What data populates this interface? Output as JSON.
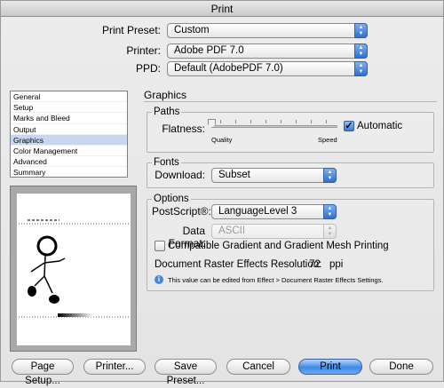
{
  "window": {
    "title": "Print"
  },
  "preset": {
    "label": "Print Preset:",
    "value": "Custom"
  },
  "printer": {
    "label": "Printer:",
    "value": "Adobe PDF 7.0"
  },
  "ppd": {
    "label": "PPD:",
    "value": "Default (AdobePDF 7.0)"
  },
  "sidebar": {
    "items": [
      {
        "label": "General"
      },
      {
        "label": "Setup"
      },
      {
        "label": "Marks and Bleed"
      },
      {
        "label": "Output"
      },
      {
        "label": "Graphics",
        "selected": true
      },
      {
        "label": "Color Management"
      },
      {
        "label": "Advanced"
      },
      {
        "label": "Summary"
      }
    ]
  },
  "main": {
    "title": "Graphics",
    "paths": {
      "title": "Paths",
      "flatness_label": "Flatness:",
      "quality_label": "Quality",
      "speed_label": "Speed",
      "automatic_label": "Automatic",
      "automatic_checked": true
    },
    "fonts": {
      "title": "Fonts",
      "download_label": "Download:",
      "download_value": "Subset"
    },
    "options": {
      "title": "Options",
      "postscript_label": "PostScript®:",
      "postscript_value": "LanguageLevel 3",
      "data_format_label": "Data Format:",
      "data_format_value": "ASCII",
      "compatible_label": "Compatible Gradient and Gradient Mesh Printing",
      "compatible_checked": false,
      "raster_label": "Document Raster Effects Resolution:",
      "raster_value": "72",
      "raster_unit": "ppi",
      "info_text": "This value can be edited from Effect > Document Raster Effects Settings."
    }
  },
  "buttons": {
    "page_setup": "Page Setup...",
    "printer": "Printer...",
    "save_preset": "Save Preset...",
    "cancel": "Cancel",
    "print": "Print",
    "done": "Done"
  }
}
